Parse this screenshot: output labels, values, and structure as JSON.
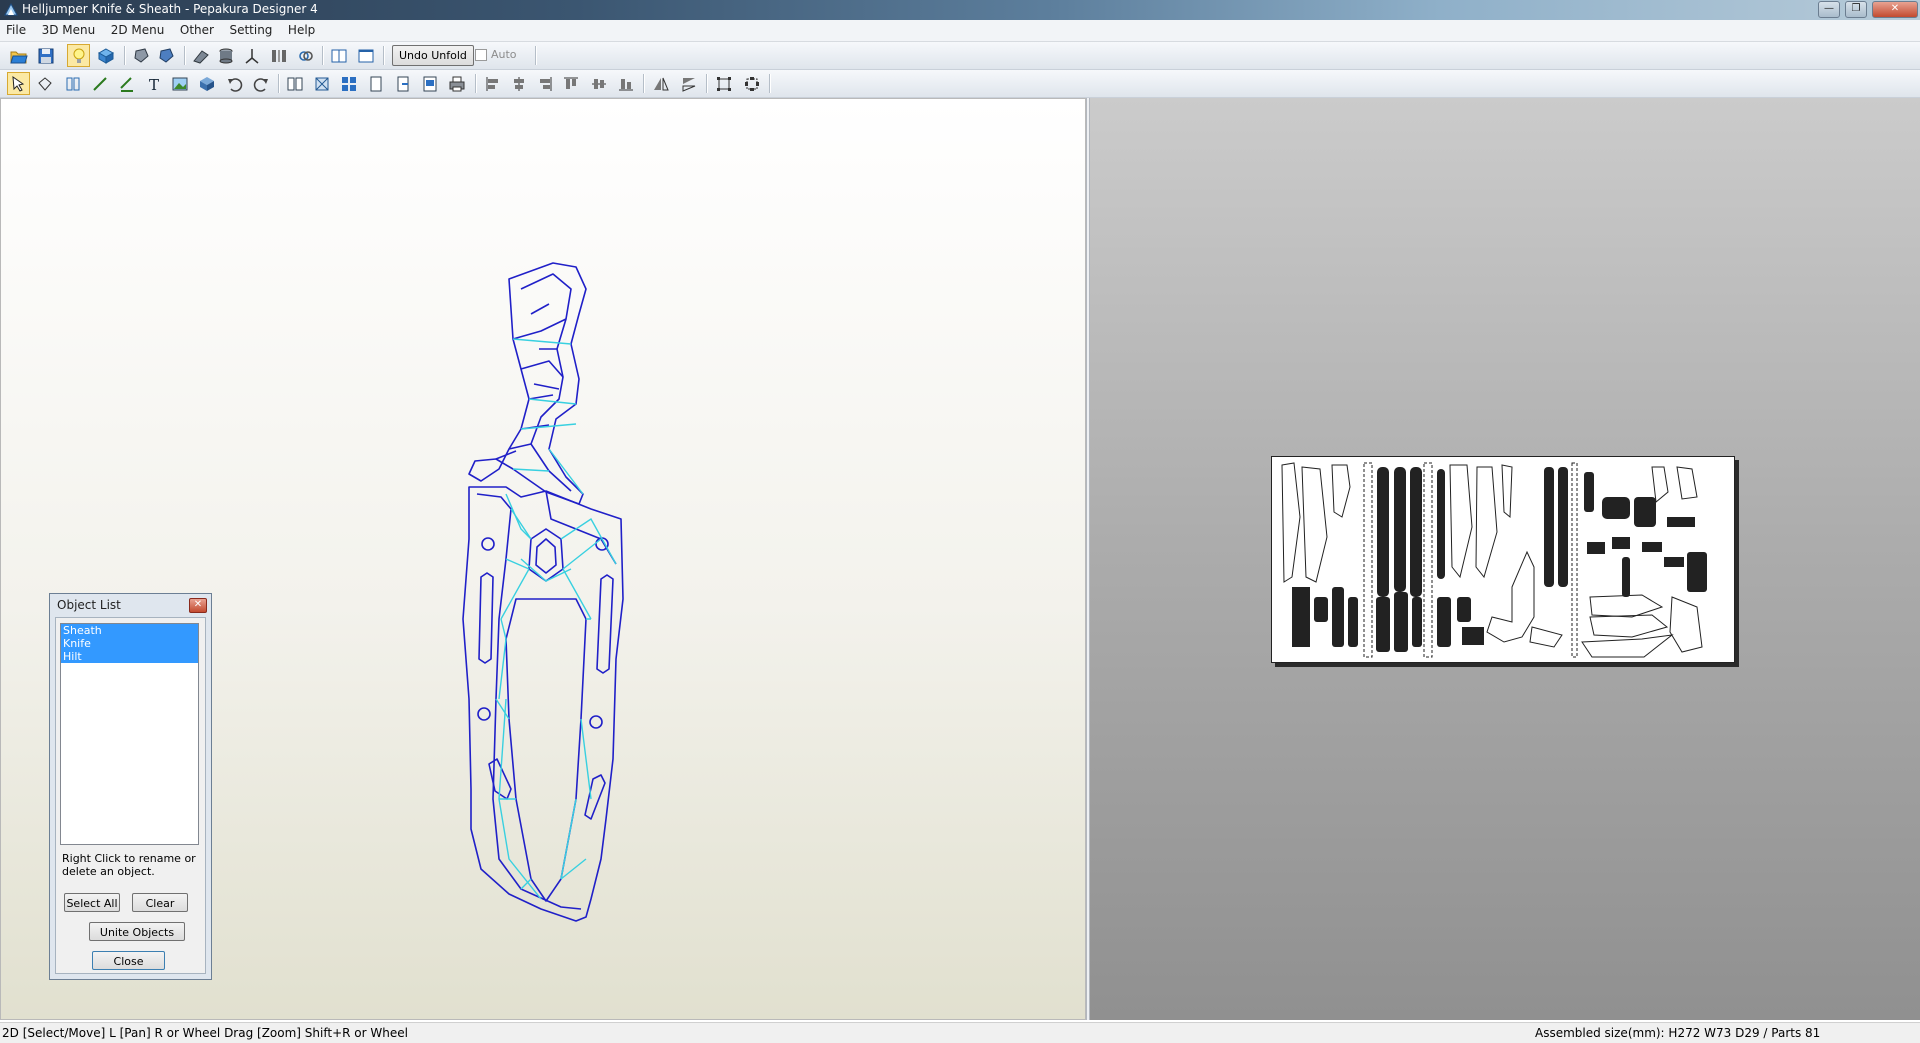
{
  "window": {
    "title": "Helljumper Knife & Sheath - Pepakura Designer 4",
    "app_icon": "pepakura-app-icon",
    "controls": [
      "minimize-icon",
      "maximize-icon",
      "close-icon"
    ]
  },
  "menubar": {
    "items": [
      "File",
      "3D Menu",
      "2D Menu",
      "Other",
      "Setting",
      "Help"
    ]
  },
  "toolbar1": {
    "icons": [
      "open-icon",
      "save-icon",
      "light-bulb-icon",
      "view-3d-icon",
      "rotate-icon",
      "texture-icon",
      "flap-icon",
      "cylinder-icon",
      "axis-icon",
      "split-view-icon",
      "link-icon",
      "two-pane-icon",
      "single-pane-icon"
    ],
    "undo_unfold_label": "Undo Unfold",
    "auto_label": "Auto",
    "auto_checked": false
  },
  "toolbar2": {
    "icons": [
      "select-move-icon",
      "lasso-icon",
      "join-edge-icon",
      "draw-line-icon",
      "fold-line-icon",
      "text-icon",
      "image-icon",
      "package-icon",
      "undo-icon",
      "redo-icon",
      "page-icon",
      "fit-icon",
      "grid-icon",
      "page-add-icon",
      "page-next-icon",
      "page-setup-icon",
      "print-icon",
      "align-left-icon",
      "align-center-icon",
      "align-right-icon",
      "align-top-icon",
      "align-middle-icon",
      "align-bottom-icon",
      "flip-h-icon",
      "flip-v-icon",
      "frame-icon",
      "transform-icon"
    ]
  },
  "object_list": {
    "title": "Object List",
    "items": [
      "Sheath",
      "Knife",
      "Hilt"
    ],
    "hint": "Right Click to rename or delete an object.",
    "select_all_label": "Select All",
    "clear_label": "Clear",
    "unite_label": "Unite Objects",
    "close_label": "Close"
  },
  "statusbar": {
    "left": "2D [Select/Move] L [Pan] R or Wheel Drag [Zoom] Shift+R or Wheel",
    "right": "Assembled size(mm): H272 W73 D29 / Parts 81"
  },
  "colors": {
    "wireframe": "#2020c8",
    "fold_lines": "#38d0e0",
    "selection": "#3399ff"
  }
}
